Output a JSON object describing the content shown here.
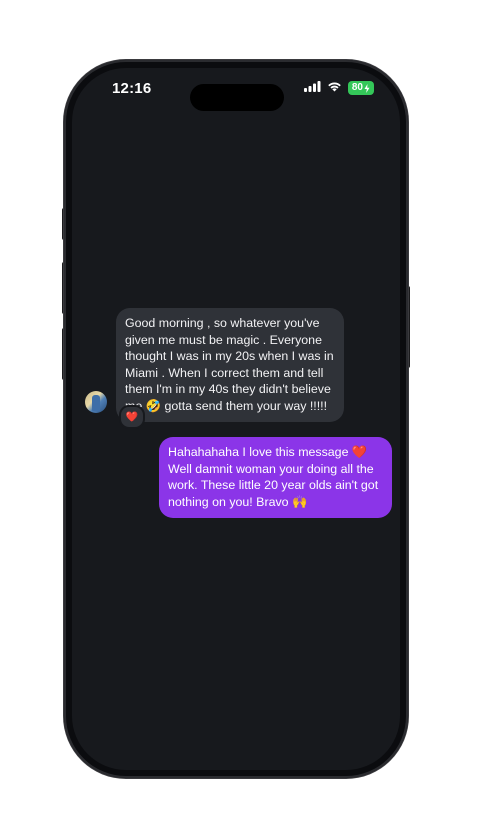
{
  "status_bar": {
    "time": "12:16",
    "battery": "80"
  },
  "chat": {
    "incoming": {
      "text": "Good morning , so whatever you've given me must be magic . Everyone thought I was in my 20s when I was in Miami . When I correct them and tell them I'm in my 40s they didn't believe me 🤣 gotta send them your way !!!!!",
      "reaction": "❤️"
    },
    "outgoing": {
      "text": "Hahahahaha I love this message ❤️ Well damnit woman your doing all the work. These little 20 year olds ain't got nothing on you! Bravo 🙌"
    }
  },
  "colors": {
    "screen_background": "#17191d",
    "incoming_bubble": "#2f3238",
    "outgoing_bubble": "#8b35e8",
    "battery": "#34c759"
  },
  "icons": [
    "signal-icon",
    "wifi-icon",
    "battery-icon",
    "heart-reaction-icon"
  ]
}
